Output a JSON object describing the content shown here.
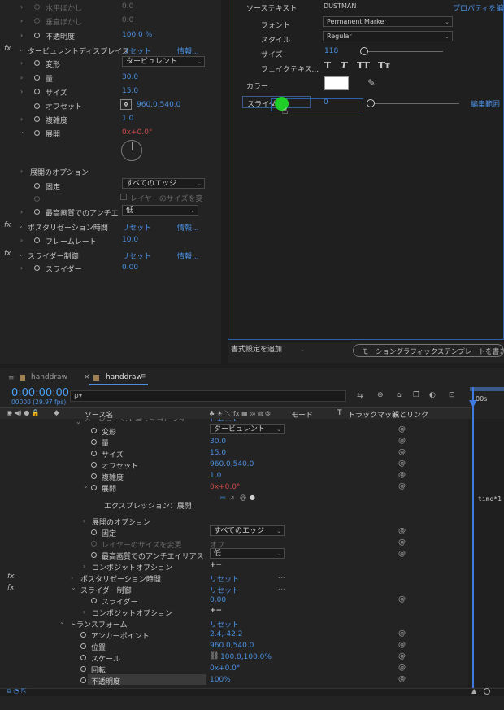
{
  "effects_panel": {
    "rows": [
      {
        "label": "水平ぼかし",
        "value": "0.0",
        "dim": true
      },
      {
        "label": "垂直ぼかし",
        "value": "0.0",
        "dim": true
      },
      {
        "label": "不透明度",
        "value": "100.0 %"
      }
    ],
    "turbulent": {
      "name": "タービュレントディスプレイス",
      "reset": "リセット",
      "info": "情報...",
      "props": [
        {
          "label": "変形",
          "value": "タービュレント"
        },
        {
          "label": "量",
          "value": "30.0"
        },
        {
          "label": "サイズ",
          "value": "15.0"
        },
        {
          "label": "オフセット",
          "value": "960.0,540.0"
        },
        {
          "label": "複雑度",
          "value": "1.0"
        },
        {
          "label": "展開",
          "value_a": "0",
          "value_b": "x+0.0°"
        }
      ],
      "evolution_options": "展開のオプション",
      "pin_label": "固定",
      "pin_value": "すべてのエッジ",
      "resize_layer": "レイヤーのサイズを変",
      "aa_label": "最高画質でのアンチエ",
      "aa_value": "低"
    },
    "posterize": {
      "name": "ポスタリゼーション時間",
      "reset": "リセット",
      "info": "情報...",
      "fr_label": "フレームレート",
      "fr_value": "10.0"
    },
    "slider": {
      "name": "スライダー制御",
      "reset": "リセット",
      "info": "情報...",
      "label": "スライダー",
      "value": "0.00"
    }
  },
  "eg_panel": {
    "source_text_label": "ソーステキスト",
    "source_text_value": "DUSTMAN",
    "prop_edit": "プロパティを編集",
    "font_label": "フォント",
    "font_value": "Permanent Marker",
    "style_label": "スタイル",
    "style_value": "Regular",
    "size_label": "サイズ",
    "size_value": "118",
    "faux_label": "フェイクテキス...",
    "faux_buttons": [
      "T",
      "T",
      "TT",
      "Tт"
    ],
    "color_label": "カラー",
    "slider_label": "スライダー",
    "slider_value": "0",
    "edit_range": "編集範囲",
    "add_format": "書式設定を追加",
    "export": "モーショングラフィックステンプレートを書き出し..."
  },
  "timeline": {
    "tabs": [
      {
        "label": "handdraw"
      },
      {
        "label": "handdraw"
      }
    ],
    "timecode": "0:00:00:00",
    "fps": "00000 (29.97 fps)",
    "search_placeholder": "ρ▾",
    "col_source": "ソース名",
    "col_mode": "モード",
    "col_t": "T",
    "col_trackmatte": "トラックマット",
    "col_parent": "親とリンク",
    "ruler_label": "00s",
    "layer_partial": "タービュレントディスプレイス",
    "reset_partial": "リセット",
    "rows": [
      {
        "label": "変形",
        "value": "タービュレント"
      },
      {
        "label": "量",
        "value": "30.0"
      },
      {
        "label": "サイズ",
        "value": "15.0"
      },
      {
        "label": "オフセット",
        "value": "960.0,540.0"
      },
      {
        "label": "複雑度",
        "value": "1.0"
      },
      {
        "label": "展開",
        "value_a": "0",
        "value_b": "x+0.0°"
      }
    ],
    "expression_label": "エクスプレッション：展開",
    "expression_text": "time*1",
    "evolution_options": "展開のオプション",
    "pin_label": "固定",
    "pin_value": "すべてのエッジ",
    "resize_label": "レイヤーのサイズを変更",
    "resize_value": "オフ",
    "aa_label": "最高画質でのアンチエイリアス",
    "aa_value": "低",
    "composite": "コンポジットオプション",
    "composite_sym": "+−",
    "posterize": "ポスタリゼーション時間",
    "slider_ctrl": "スライダー制御",
    "slider_label": "スライダー",
    "slider_value": "0.00",
    "transform": "トランスフォーム",
    "anchor_label": "アンカーポイント",
    "anchor_value": "2.4,-42.2",
    "position_label": "位置",
    "position_value": "960.0,540.0",
    "scale_label": "スケール",
    "scale_value": "100.0,100.0%",
    "rotation_label": "回転",
    "rotation_value": "0x+0.0°",
    "opacity_label": "不透明度",
    "opacity_value": "100%"
  }
}
